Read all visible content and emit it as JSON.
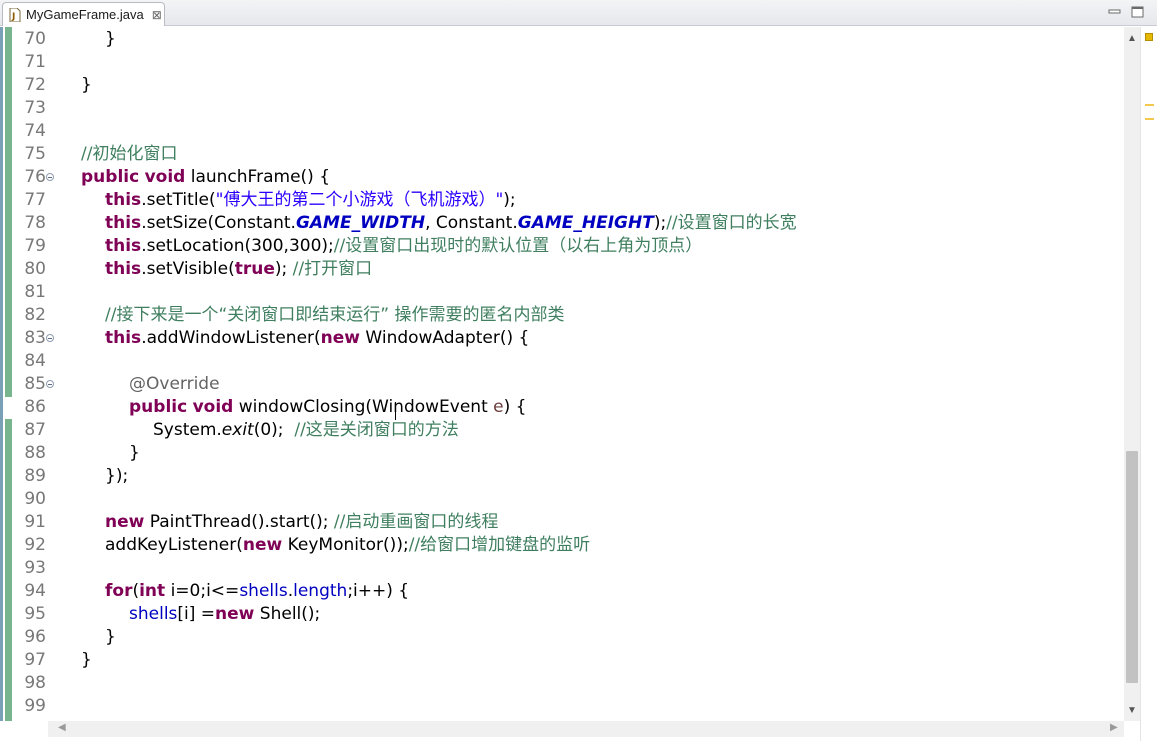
{
  "tab": {
    "title": "MyGameFrame.java",
    "close": "⊠",
    "icon": "java-file-icon"
  },
  "window_controls": {
    "minimize": "minimize-icon",
    "maximize": "maximize-icon"
  },
  "lines": [
    {
      "num": "70",
      "fold": false,
      "indent": 1,
      "tokens": [
        [
          "p",
          "}"
        ]
      ]
    },
    {
      "num": "71",
      "fold": false,
      "indent": 0,
      "tokens": []
    },
    {
      "num": "72",
      "fold": false,
      "indent": 0,
      "tokens": [
        [
          "p",
          "}"
        ]
      ]
    },
    {
      "num": "73",
      "fold": false,
      "indent": 0,
      "tokens": []
    },
    {
      "num": "74",
      "fold": false,
      "indent": 0,
      "tokens": []
    },
    {
      "num": "75",
      "fold": false,
      "indent": 0,
      "tokens": [
        [
          "cm",
          "//初始化窗口"
        ]
      ]
    },
    {
      "num": "76",
      "fold": true,
      "indent": 0,
      "tokens": [
        [
          "kw",
          "public"
        ],
        [
          "p",
          " "
        ],
        [
          "kw",
          "void"
        ],
        [
          "p",
          " launchFrame() {"
        ]
      ]
    },
    {
      "num": "77",
      "fold": false,
      "indent": 1,
      "tokens": [
        [
          "kw",
          "this"
        ],
        [
          "p",
          ".setTitle("
        ],
        [
          "st",
          "\"傅大王的第二个小游戏（飞机游戏）\""
        ],
        [
          "p",
          ");"
        ]
      ]
    },
    {
      "num": "78",
      "fold": false,
      "indent": 1,
      "tokens": [
        [
          "kw",
          "this"
        ],
        [
          "p",
          ".setSize(Constant."
        ],
        [
          "sfld",
          "GAME_WIDTH"
        ],
        [
          "p",
          ", Constant."
        ],
        [
          "sfld",
          "GAME_HEIGHT"
        ],
        [
          "p",
          ");"
        ],
        [
          "cm",
          "//设置窗口的长宽"
        ]
      ]
    },
    {
      "num": "79",
      "fold": false,
      "indent": 1,
      "tokens": [
        [
          "kw",
          "this"
        ],
        [
          "p",
          ".setLocation(300,300);"
        ],
        [
          "cm",
          "//设置窗口出现时的默认位置（以右上角为顶点）"
        ]
      ]
    },
    {
      "num": "80",
      "fold": false,
      "indent": 1,
      "tokens": [
        [
          "kw",
          "this"
        ],
        [
          "p",
          ".setVisible("
        ],
        [
          "kw",
          "true"
        ],
        [
          "p",
          "); "
        ],
        [
          "cm",
          "//打开窗口"
        ]
      ]
    },
    {
      "num": "81",
      "fold": false,
      "indent": 0,
      "tokens": []
    },
    {
      "num": "82",
      "fold": false,
      "indent": 1,
      "tokens": [
        [
          "cm",
          "//接下来是一个“关闭窗口即结束运行” 操作需要的匿名内部类"
        ]
      ]
    },
    {
      "num": "83",
      "fold": true,
      "indent": 1,
      "tokens": [
        [
          "kw",
          "this"
        ],
        [
          "p",
          ".addWindowListener("
        ],
        [
          "kw",
          "new"
        ],
        [
          "p",
          " WindowAdapter() {"
        ]
      ]
    },
    {
      "num": "84",
      "fold": false,
      "indent": 0,
      "tokens": []
    },
    {
      "num": "85",
      "fold": true,
      "indent": 2,
      "tokens": [
        [
          "ann",
          "@Override"
        ]
      ]
    },
    {
      "num": "86",
      "fold": false,
      "indent": 2,
      "tokens": [
        [
          "kw",
          "public"
        ],
        [
          "p",
          " "
        ],
        [
          "kw",
          "void"
        ],
        [
          "p",
          " windowClosing(WindowEvent "
        ],
        [
          "var",
          "e"
        ],
        [
          "p",
          ") {"
        ]
      ]
    },
    {
      "num": "87",
      "fold": false,
      "indent": 3,
      "tokens": [
        [
          "p",
          "System."
        ],
        [
          "smth",
          "exit"
        ],
        [
          "p",
          "(0);  "
        ],
        [
          "cm",
          "//这是关闭窗口的方法"
        ]
      ]
    },
    {
      "num": "88",
      "fold": false,
      "indent": 2,
      "tokens": [
        [
          "p",
          "}"
        ]
      ]
    },
    {
      "num": "89",
      "fold": false,
      "indent": 1,
      "tokens": [
        [
          "p",
          "});"
        ]
      ]
    },
    {
      "num": "90",
      "fold": false,
      "indent": 0,
      "tokens": []
    },
    {
      "num": "91",
      "fold": false,
      "indent": 1,
      "tokens": [
        [
          "kw",
          "new"
        ],
        [
          "p",
          " PaintThread().start(); "
        ],
        [
          "cm",
          "//启动重画窗口的线程"
        ]
      ]
    },
    {
      "num": "92",
      "fold": false,
      "indent": 1,
      "tokens": [
        [
          "p",
          "addKeyListener("
        ],
        [
          "kw",
          "new"
        ],
        [
          "p",
          " KeyMonitor());"
        ],
        [
          "cm",
          "//给窗口增加键盘的监听"
        ]
      ]
    },
    {
      "num": "93",
      "fold": false,
      "indent": 0,
      "tokens": []
    },
    {
      "num": "94",
      "fold": false,
      "indent": 1,
      "tokens": [
        [
          "kw",
          "for"
        ],
        [
          "p",
          "("
        ],
        [
          "kw",
          "int"
        ],
        [
          "p",
          " i=0;i<="
        ],
        [
          "fld",
          "shells"
        ],
        [
          "p",
          "."
        ],
        [
          "fld",
          "length"
        ],
        [
          "p",
          ";i++) {"
        ]
      ]
    },
    {
      "num": "95",
      "fold": false,
      "indent": 2,
      "tokens": [
        [
          "fld",
          "shells"
        ],
        [
          "p",
          "[i] ="
        ],
        [
          "kw",
          "new"
        ],
        [
          "p",
          " Shell();"
        ]
      ]
    },
    {
      "num": "96",
      "fold": false,
      "indent": 1,
      "tokens": [
        [
          "p",
          "}"
        ]
      ]
    },
    {
      "num": "97",
      "fold": false,
      "indent": 0,
      "tokens": [
        [
          "p",
          "}"
        ]
      ]
    },
    {
      "num": "98",
      "fold": false,
      "indent": 0,
      "tokens": []
    },
    {
      "num": "99",
      "fold": false,
      "indent": 0,
      "tokens": []
    }
  ],
  "scrollbar": {
    "up": "▲",
    "down": "▼",
    "left": "◀",
    "right": "▶"
  },
  "colors": {
    "keyword": "#7f0055",
    "comment": "#3f7f5f",
    "string": "#2a00ff",
    "field": "#0000c0",
    "annotation": "#646464",
    "change_bar": "#78b48e"
  }
}
